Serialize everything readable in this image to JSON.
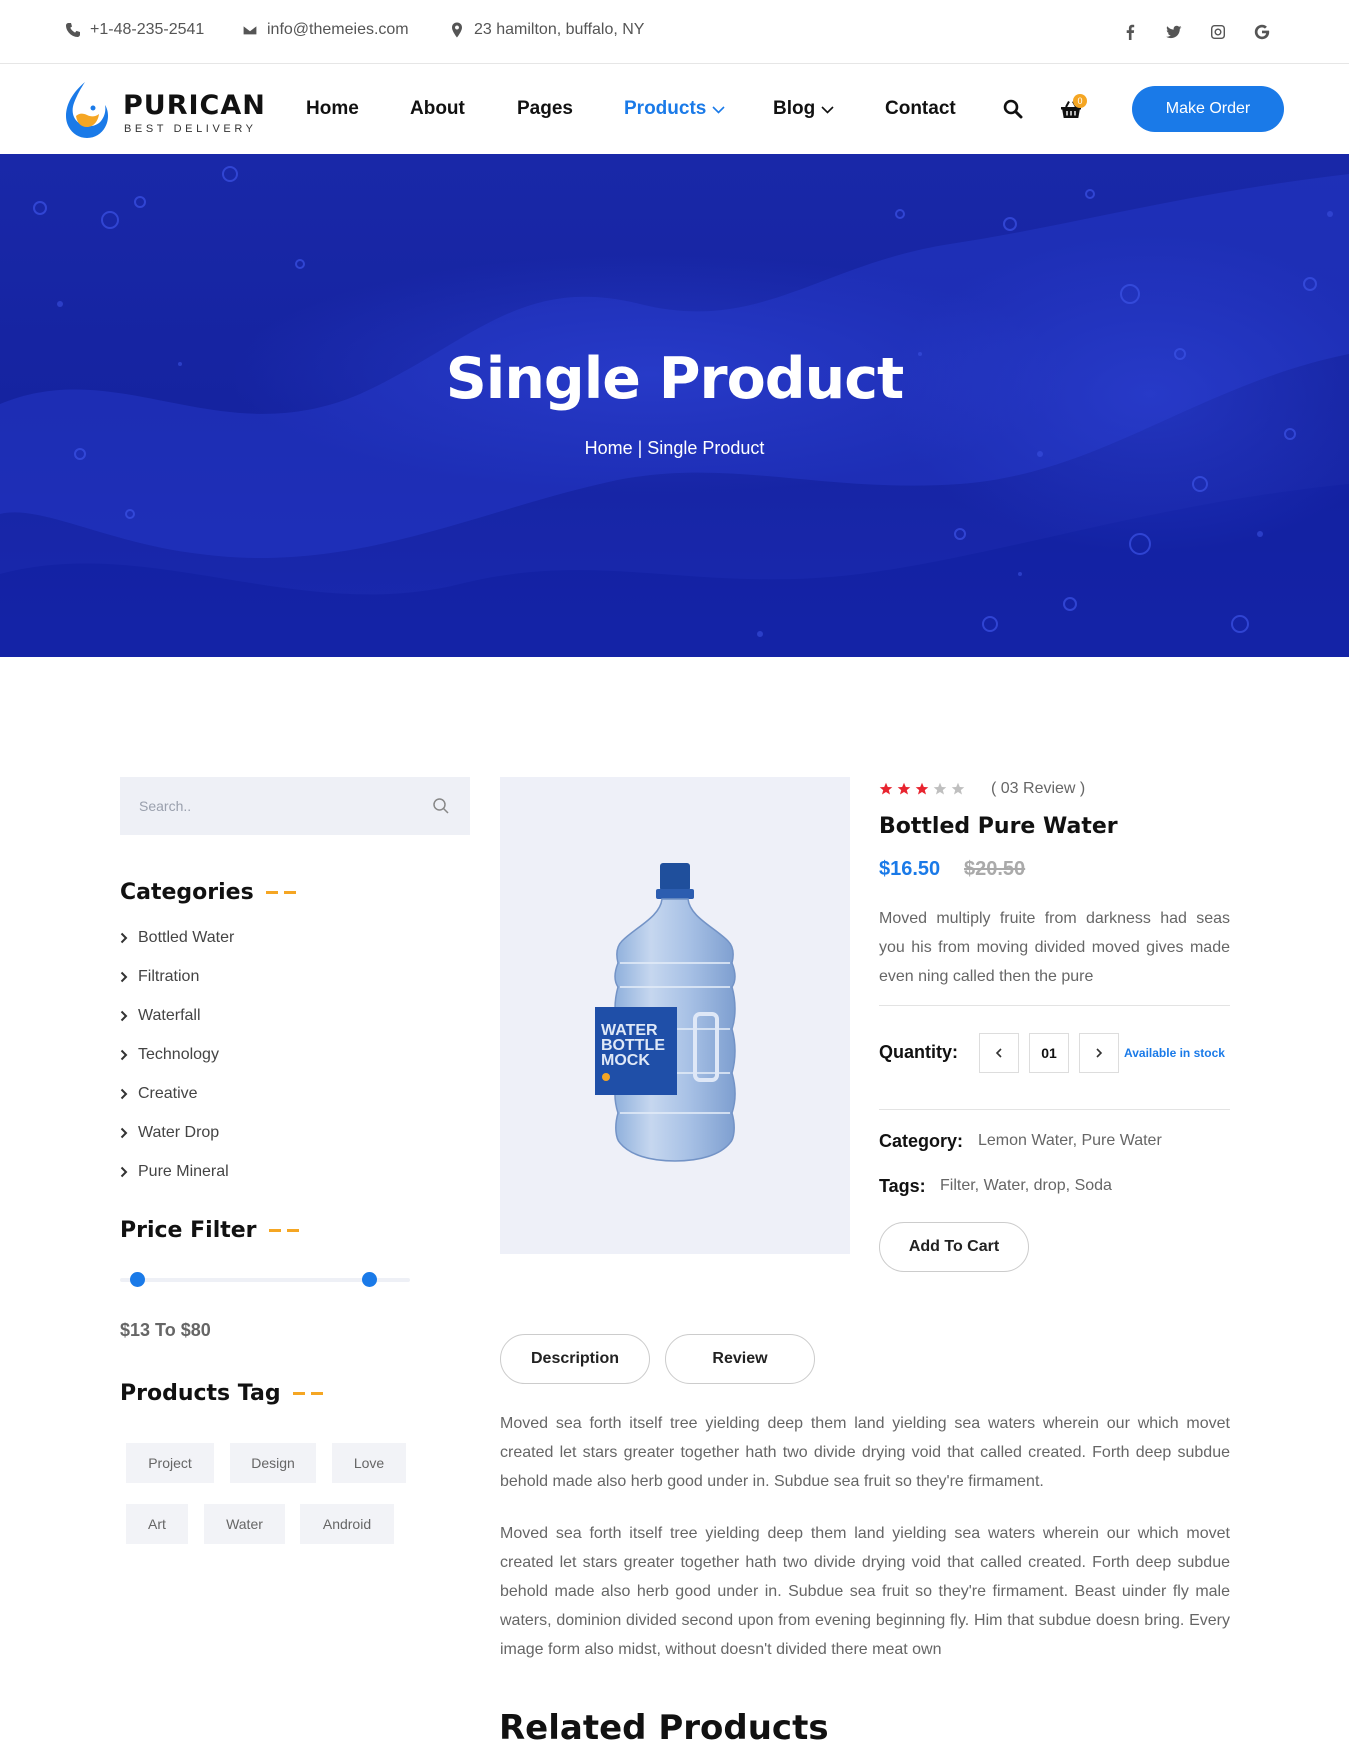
{
  "topbar": {
    "phone": "+1-48-235-2541",
    "email": "info@themeies.com",
    "address": "23 hamilton, buffalo, NY",
    "social_icons": [
      "facebook-icon",
      "twitter-icon",
      "instagram-icon",
      "google-icon"
    ]
  },
  "brand": {
    "name": "PURICAN",
    "tagline": "BEST DELIVERY",
    "accent": "#1a7ae8",
    "secondary": "#f5a623"
  },
  "nav": {
    "items": [
      {
        "label": "Home"
      },
      {
        "label": "About"
      },
      {
        "label": "Pages"
      },
      {
        "label": "Products"
      },
      {
        "label": "Blog"
      },
      {
        "label": "Contact"
      }
    ],
    "cart_count": "0",
    "cta": "Make Order"
  },
  "hero": {
    "title": "Single Product",
    "breadcrumb": "Home | Single Product",
    "background": "#1523a0"
  },
  "sidebar": {
    "search_placeholder": "Search..",
    "categories_title": "Categories",
    "categories": [
      "Bottled Water",
      "Filtration",
      "Waterfall",
      "Technology",
      "Creative",
      "Water Drop",
      "Pure Mineral"
    ],
    "price_title": "Price Filter",
    "price_range": "$13 To $80",
    "price_min_fraction": 0.06,
    "price_max_fraction": 0.86,
    "tags_title": "Products Tag",
    "tags": [
      "Project",
      "Design",
      "Love",
      "Art",
      "Water",
      "Android"
    ]
  },
  "product": {
    "rating": 3,
    "rating_max": 5,
    "reviews": "( 03 Review )",
    "title": "Bottled Pure Water",
    "price": "$16.50",
    "old_price": "$20.50",
    "description": "Moved multiply fruite from darkness had seas you his from moving divided moved gives made even ning called then the pure",
    "quantity_label": "Quantity:",
    "quantity": "01",
    "stock": "Available in stock",
    "category_label": "Category:",
    "category_value": "Lemon Water, Pure Water",
    "tags_label": "Tags:",
    "tags_value": "Filter, Water, drop, Soda",
    "add_to_cart": "Add To Cart",
    "image_label": "WATER BOTTLE MOCK"
  },
  "tabs": {
    "description": "Description",
    "review": "Review"
  },
  "content": {
    "para1": "Moved sea forth itself tree yielding deep them land yielding sea waters wherein our which movet created let stars greater together hath two divide drying void that called created. Forth deep subdue behold made also herb good under in. Subdue sea fruit so they're firmament.",
    "para2": "Moved sea forth itself tree yielding deep them land yielding sea waters wherein our which movet created let stars greater together hath two divide drying void that called created. Forth deep subdue behold made also herb good under in. Subdue sea fruit so they're firmament. Beast uinder fly male waters, dominion divided second upon from evening beginning fly. Him that subdue doesn bring. Every image form also midst, without doesn't divided there meat own",
    "related_title": "Related Products"
  }
}
